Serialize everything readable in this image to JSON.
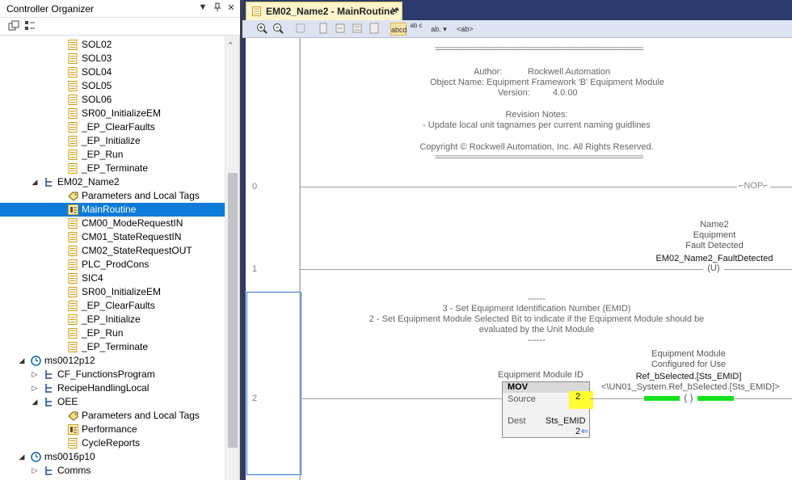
{
  "organizer": {
    "title": "Controller Organizer",
    "controls": [
      "▼",
      "ᵖ",
      "✕"
    ],
    "tree": [
      {
        "label": "SOL02",
        "icon": "routine-icon",
        "depth": 4
      },
      {
        "label": "SOL03",
        "icon": "routine-icon",
        "depth": 4
      },
      {
        "label": "SOL04",
        "icon": "routine-icon",
        "depth": 4
      },
      {
        "label": "SOL05",
        "icon": "routine-icon",
        "depth": 4
      },
      {
        "label": "SOL06",
        "icon": "routine-icon",
        "depth": 4
      },
      {
        "label": "SR00_InitializeEM",
        "icon": "routine-icon",
        "depth": 4
      },
      {
        "label": "_EP_ClearFaults",
        "icon": "routine-icon",
        "depth": 4
      },
      {
        "label": "_EP_Initialize",
        "icon": "routine-icon",
        "depth": 4
      },
      {
        "label": "_EP_Run",
        "icon": "routine-icon",
        "depth": 4
      },
      {
        "label": "_EP_Terminate",
        "icon": "routine-icon",
        "depth": 4
      },
      {
        "label": "EM02_Name2",
        "icon": "program-icon",
        "depth": 3,
        "expander": "◢"
      },
      {
        "label": "Parameters and Local Tags",
        "icon": "tag-icon",
        "depth": 4
      },
      {
        "label": "MainRoutine",
        "icon": "main-routine-icon",
        "depth": 4,
        "selected": true
      },
      {
        "label": "CM00_ModeRequestIN",
        "icon": "routine-icon",
        "depth": 4
      },
      {
        "label": "CM01_StateRequestIN",
        "icon": "routine-icon",
        "depth": 4
      },
      {
        "label": "CM02_StateRequestOUT",
        "icon": "routine-icon",
        "depth": 4
      },
      {
        "label": "PLC_ProdCons",
        "icon": "routine-icon",
        "depth": 4
      },
      {
        "label": "SIC4",
        "icon": "routine-icon",
        "depth": 4
      },
      {
        "label": "SR00_InitializeEM",
        "icon": "routine-icon",
        "depth": 4
      },
      {
        "label": "_EP_ClearFaults",
        "icon": "routine-icon",
        "depth": 4
      },
      {
        "label": "_EP_Initialize",
        "icon": "routine-icon",
        "depth": 4
      },
      {
        "label": "_EP_Run",
        "icon": "routine-icon",
        "depth": 4
      },
      {
        "label": "_EP_Terminate",
        "icon": "routine-icon",
        "depth": 4
      },
      {
        "label": "ms0012p12",
        "icon": "task-clock-icon",
        "depth": 2,
        "expander": "◢"
      },
      {
        "label": "CF_FunctionsProgram",
        "icon": "program-icon",
        "depth": 3,
        "expander": "▷"
      },
      {
        "label": "RecipeHandlingLocal",
        "icon": "program-icon",
        "depth": 3,
        "expander": "▷"
      },
      {
        "label": "OEE",
        "icon": "program-icon",
        "depth": 3,
        "expander": "◢"
      },
      {
        "label": "Parameters and Local Tags",
        "icon": "tag-icon",
        "depth": 4
      },
      {
        "label": "Performance",
        "icon": "main-routine-icon",
        "depth": 4
      },
      {
        "label": "CycleReports",
        "icon": "routine-icon",
        "depth": 4
      },
      {
        "label": "ms0016p10",
        "icon": "task-clock-icon",
        "depth": 2,
        "expander": "◢"
      },
      {
        "label": "Comms",
        "icon": "program-icon",
        "depth": 3,
        "expander": "▷"
      }
    ]
  },
  "editor": {
    "tab_title": "EM02_Name2 - MainRoutine*",
    "tab_close": "✕",
    "toolbar": [
      "zoom-in-icon",
      "zoom-out-icon",
      "fit-icon",
      "rung-icon",
      "branch-icon",
      "xic-icon",
      "ote-icon",
      "tag-view-icon",
      "desc-icon",
      "tag-icon",
      "more-icon"
    ],
    "toolbar_labels": {
      "abcd": "abcd",
      "ab_c": "ab\nc",
      "ab_dropdown": "ab. ▾",
      "ab_paren": "<ab>"
    },
    "rung0": {
      "number": "0",
      "separator": "=================================================",
      "author_label": "Author:",
      "author_value": "Rockwell Automation",
      "object_label": "Object Name:",
      "object_value": "Equipment Framework 'B' Equipment Module",
      "version_label": "Version:",
      "version_value": "4.0.00",
      "revision_title": "Revision Notes:",
      "revision_line": "- Update local unit tagnames per current naming guidlines",
      "copyright": "Copyright © Rockwell Automation, Inc.  All Rights Reserved.",
      "nop": "NOP"
    },
    "rung1": {
      "number": "1",
      "desc1": "Name2",
      "desc2": "Equipment",
      "desc3": "Fault Detected",
      "tag": "EM02_Name2_FaultDetected",
      "coil": "U"
    },
    "rung2": {
      "number": "2",
      "dashes": "------",
      "line1": "3 - Set Equipment Identification Number (EMID)",
      "line2": "2 - Set Equipment Module Selected Bit to indicate if the Equipment Module should be",
      "line3": "evaluated by the Unit Module",
      "mov_desc": "Equipment Module ID",
      "mov_title": "MOV",
      "source_label": "Source",
      "source_value": "2",
      "dest_label": "Dest",
      "dest_tag": "Sts_EMID",
      "dest_value": "2",
      "coil_desc1": "Equipment Module",
      "coil_desc2": "Configured for Use",
      "coil_tag": "Ref_bSelected.[Sts_EMID]",
      "coil_alias": "<\\UN01_System.Ref_bSelected.[Sts_EMID]>"
    }
  }
}
